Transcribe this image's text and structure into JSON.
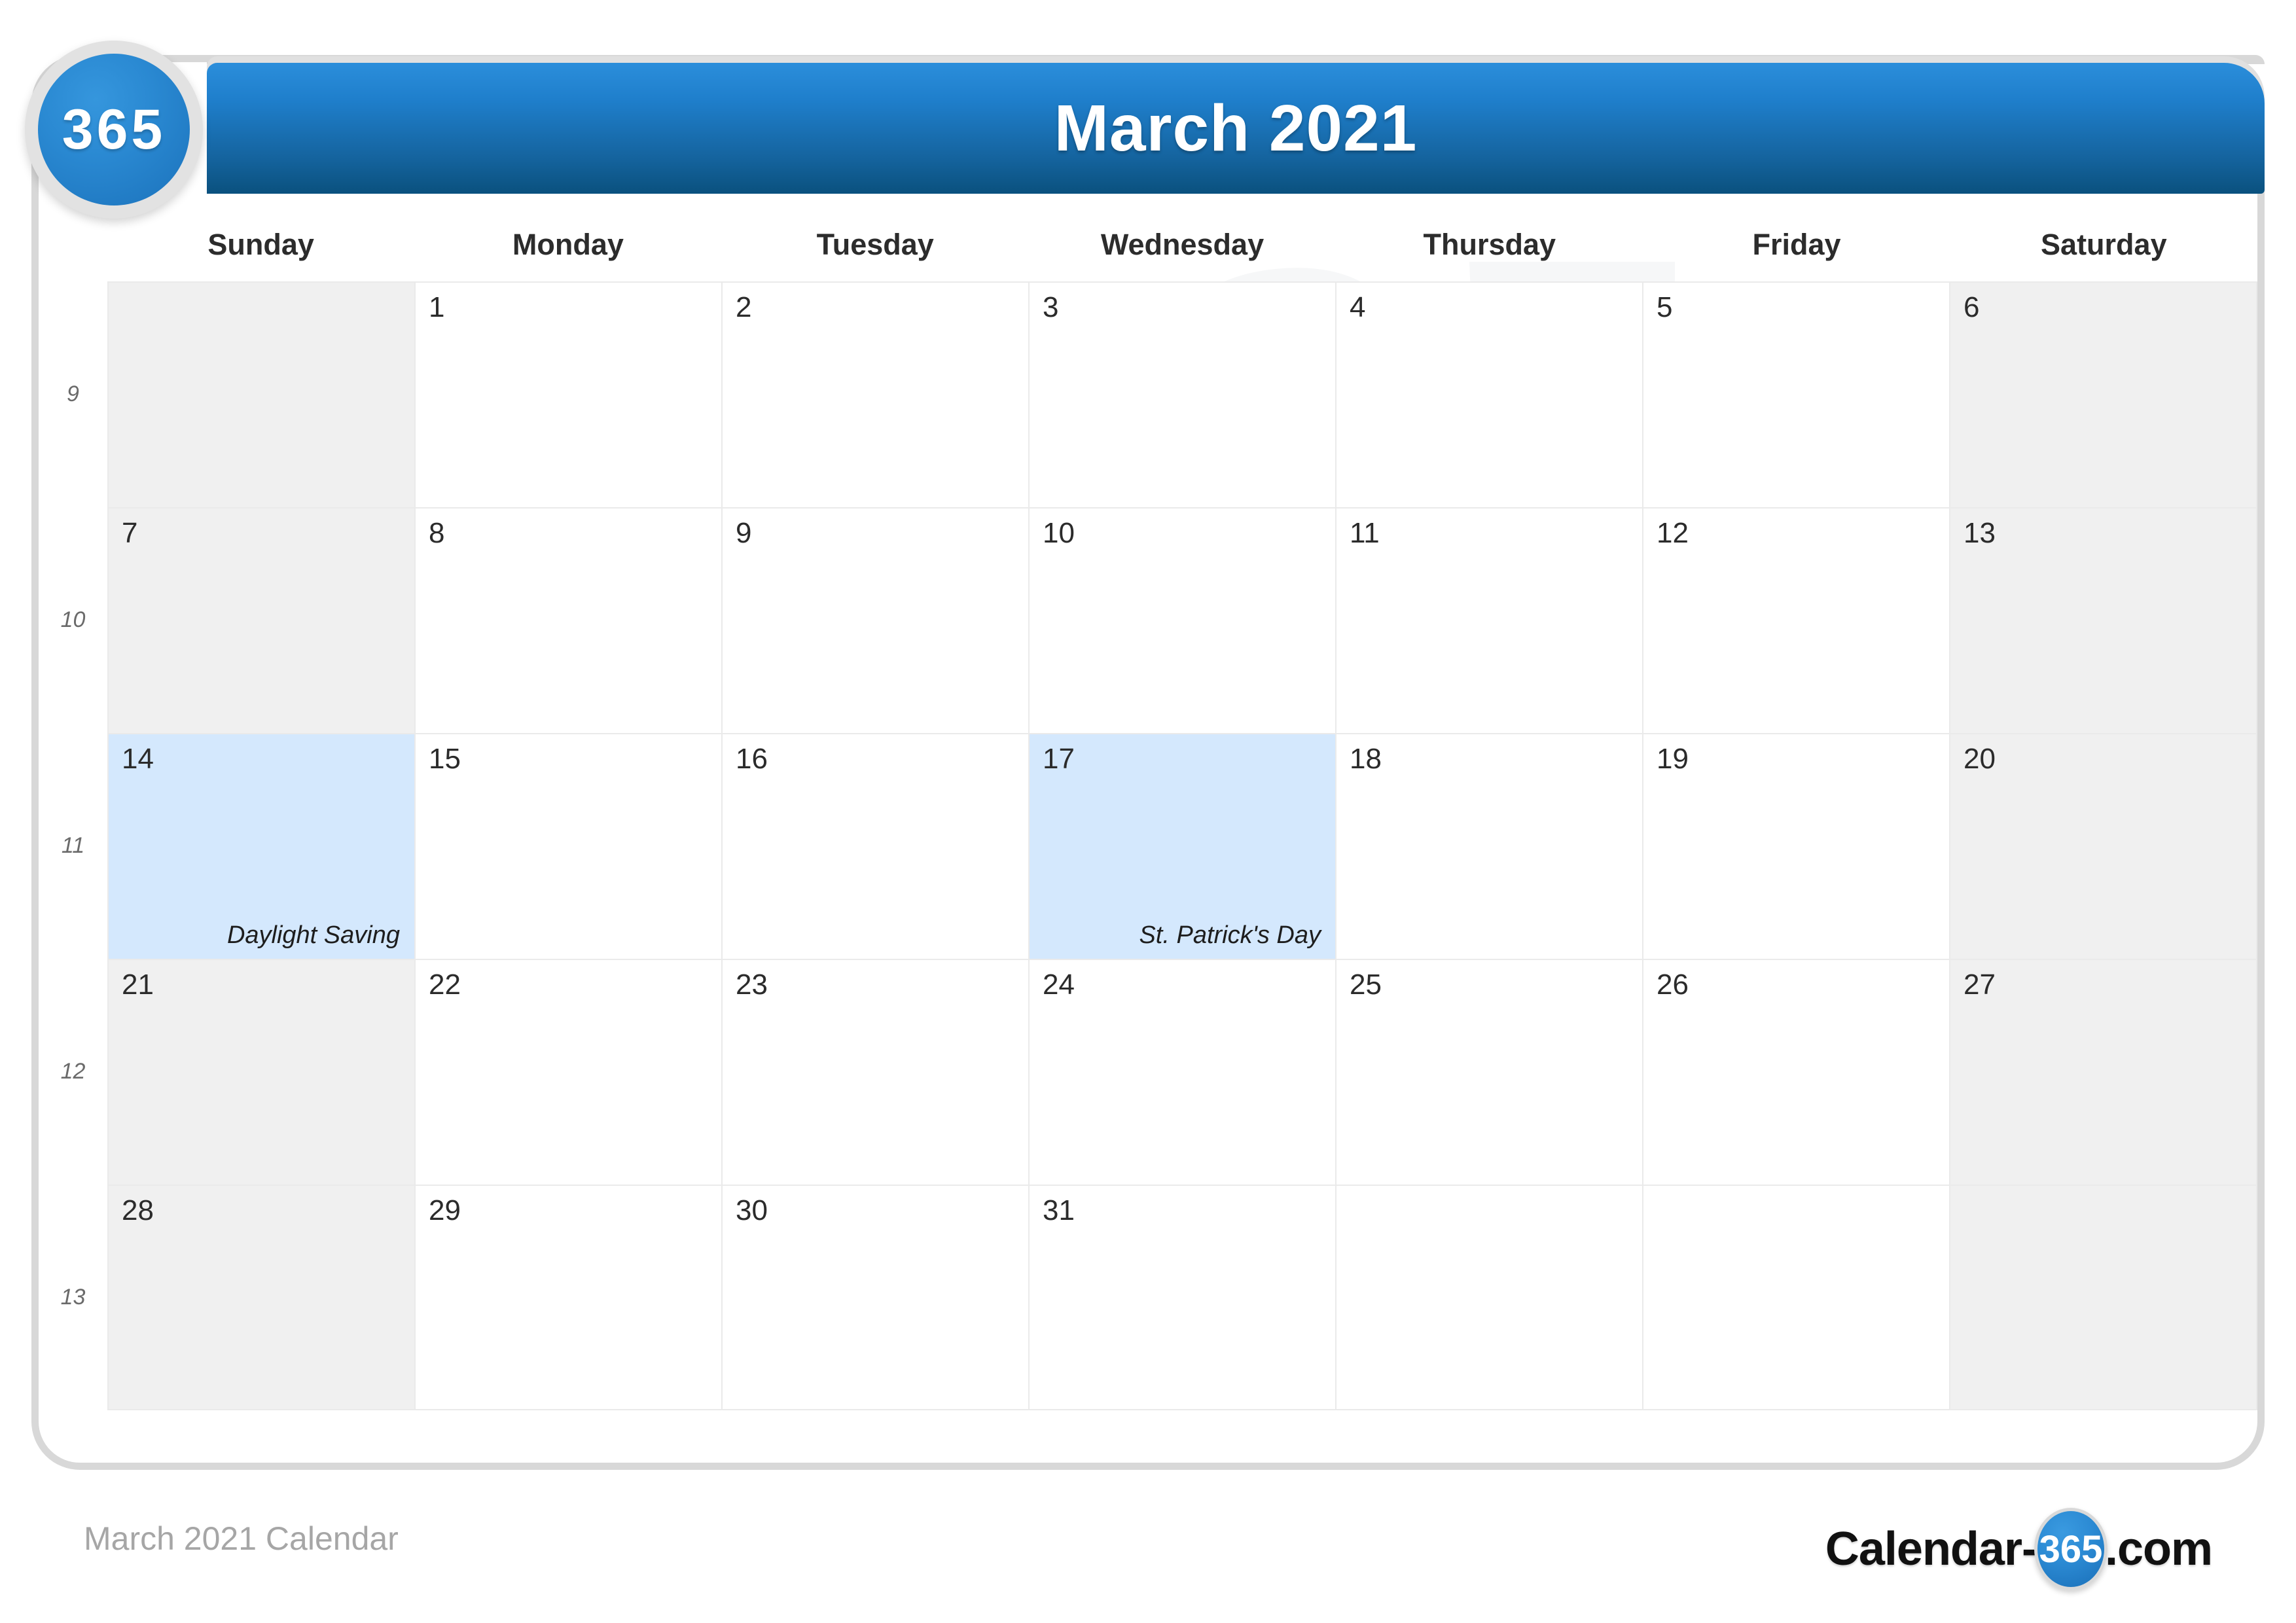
{
  "logo": {
    "badge_text": "365"
  },
  "header": {
    "title": "March 2021"
  },
  "weekdays": [
    "Sunday",
    "Monday",
    "Tuesday",
    "Wednesday",
    "Thursday",
    "Friday",
    "Saturday"
  ],
  "week_numbers": [
    "9",
    "10",
    "11",
    "12",
    "13"
  ],
  "weeks": [
    {
      "number": "9",
      "days": [
        {
          "num": "",
          "event": "",
          "blank": true,
          "weekend": true,
          "highlight": false
        },
        {
          "num": "1",
          "event": "",
          "blank": false,
          "weekend": false,
          "highlight": false
        },
        {
          "num": "2",
          "event": "",
          "blank": false,
          "weekend": false,
          "highlight": false
        },
        {
          "num": "3",
          "event": "",
          "blank": false,
          "weekend": false,
          "highlight": false
        },
        {
          "num": "4",
          "event": "",
          "blank": false,
          "weekend": false,
          "highlight": false
        },
        {
          "num": "5",
          "event": "",
          "blank": false,
          "weekend": false,
          "highlight": false
        },
        {
          "num": "6",
          "event": "",
          "blank": false,
          "weekend": true,
          "highlight": false
        }
      ]
    },
    {
      "number": "10",
      "days": [
        {
          "num": "7",
          "event": "",
          "blank": false,
          "weekend": true,
          "highlight": false
        },
        {
          "num": "8",
          "event": "",
          "blank": false,
          "weekend": false,
          "highlight": false
        },
        {
          "num": "9",
          "event": "",
          "blank": false,
          "weekend": false,
          "highlight": false
        },
        {
          "num": "10",
          "event": "",
          "blank": false,
          "weekend": false,
          "highlight": false
        },
        {
          "num": "11",
          "event": "",
          "blank": false,
          "weekend": false,
          "highlight": false
        },
        {
          "num": "12",
          "event": "",
          "blank": false,
          "weekend": false,
          "highlight": false
        },
        {
          "num": "13",
          "event": "",
          "blank": false,
          "weekend": true,
          "highlight": false
        }
      ]
    },
    {
      "number": "11",
      "days": [
        {
          "num": "14",
          "event": "Daylight Saving",
          "blank": false,
          "weekend": true,
          "highlight": true
        },
        {
          "num": "15",
          "event": "",
          "blank": false,
          "weekend": false,
          "highlight": false
        },
        {
          "num": "16",
          "event": "",
          "blank": false,
          "weekend": false,
          "highlight": false
        },
        {
          "num": "17",
          "event": "St. Patrick's Day",
          "blank": false,
          "weekend": false,
          "highlight": true
        },
        {
          "num": "18",
          "event": "",
          "blank": false,
          "weekend": false,
          "highlight": false
        },
        {
          "num": "19",
          "event": "",
          "blank": false,
          "weekend": false,
          "highlight": false
        },
        {
          "num": "20",
          "event": "",
          "blank": false,
          "weekend": true,
          "highlight": false
        }
      ]
    },
    {
      "number": "12",
      "days": [
        {
          "num": "21",
          "event": "",
          "blank": false,
          "weekend": true,
          "highlight": false
        },
        {
          "num": "22",
          "event": "",
          "blank": false,
          "weekend": false,
          "highlight": false
        },
        {
          "num": "23",
          "event": "",
          "blank": false,
          "weekend": false,
          "highlight": false
        },
        {
          "num": "24",
          "event": "",
          "blank": false,
          "weekend": false,
          "highlight": false
        },
        {
          "num": "25",
          "event": "",
          "blank": false,
          "weekend": false,
          "highlight": false
        },
        {
          "num": "26",
          "event": "",
          "blank": false,
          "weekend": false,
          "highlight": false
        },
        {
          "num": "27",
          "event": "",
          "blank": false,
          "weekend": true,
          "highlight": false
        }
      ]
    },
    {
      "number": "13",
      "days": [
        {
          "num": "28",
          "event": "",
          "blank": false,
          "weekend": true,
          "highlight": false
        },
        {
          "num": "29",
          "event": "",
          "blank": false,
          "weekend": false,
          "highlight": false
        },
        {
          "num": "30",
          "event": "",
          "blank": false,
          "weekend": false,
          "highlight": false
        },
        {
          "num": "31",
          "event": "",
          "blank": false,
          "weekend": false,
          "highlight": false
        },
        {
          "num": "",
          "event": "",
          "blank": true,
          "weekend": false,
          "highlight": false
        },
        {
          "num": "",
          "event": "",
          "blank": true,
          "weekend": false,
          "highlight": false
        },
        {
          "num": "",
          "event": "",
          "blank": true,
          "weekend": true,
          "highlight": false
        }
      ]
    }
  ],
  "watermark": {
    "line1": "365",
    "line2": "365"
  },
  "footer": {
    "caption": "March 2021 Calendar",
    "logo_prefix": "Calendar-",
    "logo_badge": "365",
    "logo_suffix": ".com"
  },
  "colors": {
    "header_gradient_top": "#2b8edb",
    "header_gradient_bottom": "#0a517e",
    "accent_blue": "#2c8bd4",
    "highlight_day": "#d4e8fd",
    "weekend_cell": "#f0f0f0",
    "grid_line": "#eaeaea",
    "frame_border": "#d8d8d8",
    "footer_text": "#a6a6a6"
  }
}
